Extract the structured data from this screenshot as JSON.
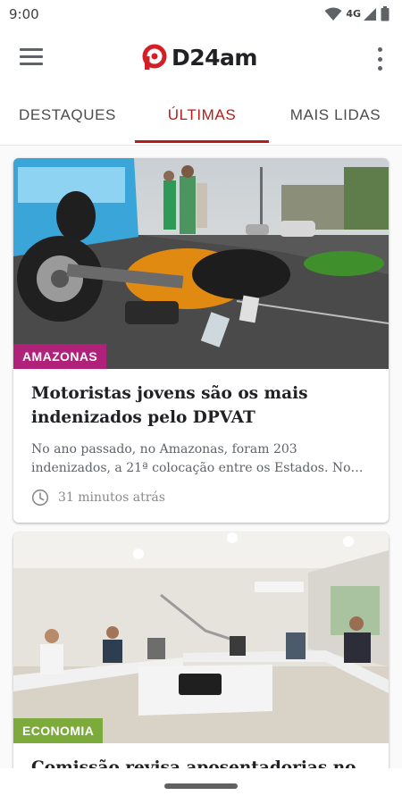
{
  "status_bar": {
    "time": "9:00",
    "network": "4G",
    "icons": [
      "wifi-icon",
      "signal-icon",
      "battery-icon"
    ]
  },
  "app_bar": {
    "logo_text": "D24am",
    "menu_icon": "hamburger-menu-icon",
    "more_icon": "more-vertical-icon"
  },
  "tabs": [
    {
      "label": "DESTAQUES",
      "active": false
    },
    {
      "label": "ÚLTIMAS",
      "active": true
    },
    {
      "label": "MAIS LIDAS",
      "active": false
    }
  ],
  "colors": {
    "accent": "#b71c1c",
    "amazonas_tag": "#b0217a",
    "economia_tag": "#7cab3b"
  },
  "articles": [
    {
      "category": "AMAZONAS",
      "title": "Motoristas jovens são os mais indenizados pelo DPVAT",
      "excerpt": "No ano passado, no Amazonas, foram 203 indenizados, a 21ª colocação entre os Estados. No Pa...",
      "time": "31 minutos atrás",
      "image_subject": "motorcycle-accident-photo"
    },
    {
      "category": "ECONOMIA",
      "title": "Comissão revisa aposentadorias no",
      "image_subject": "meeting-room-photo"
    }
  ]
}
